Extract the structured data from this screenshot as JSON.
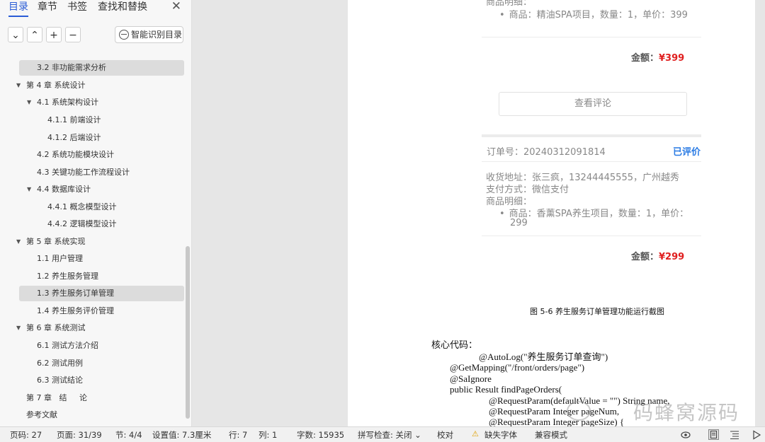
{
  "sidebar": {
    "tabs": [
      "目录",
      "章节",
      "书签",
      "查找和替换"
    ],
    "close_glyph": "✕",
    "tool_buttons": [
      "⌄",
      "⌃",
      "+",
      "−"
    ],
    "ai_button_label": "智能识别目录",
    "toc_items": [
      {
        "label": "3.2  非功能需求分析"
      },
      {
        "label": "第 4 章  系统设计"
      },
      {
        "label": "4.1  系统架构设计"
      },
      {
        "label": "4.1.1  前端设计"
      },
      {
        "label": "4.1.2  后端设计"
      },
      {
        "label": "4.2  系统功能模块设计"
      },
      {
        "label": "4.3  关键功能工作流程设计"
      },
      {
        "label": "4.4  数据库设计"
      },
      {
        "label": "4.4.1  概念模型设计"
      },
      {
        "label": "4.4.2  逻辑模型设计"
      },
      {
        "label": "第 5 章  系统实现"
      },
      {
        "label": "1.1  用户管理"
      },
      {
        "label": "1.2  养生服务管理"
      },
      {
        "label": "1.3  养生服务订单管理"
      },
      {
        "label": "1.4  养生服务评价管理"
      },
      {
        "label": "第 6 章  系统测试"
      },
      {
        "label": "6.1  测试方法介绍"
      },
      {
        "label": "6.2  测试用例"
      },
      {
        "label": "6.3  测试结论"
      },
      {
        "label": "第 7 章   结     论"
      },
      {
        "label": "参考文献"
      }
    ]
  },
  "document": {
    "top_partial": "商品明细：",
    "order1_item": "商品：精油SPA项目，数量：1，单价：399",
    "amount_label": "金额：",
    "order1_amount": "¥399",
    "review_button": "查看评论",
    "order2_number": "订单号：20240312091814",
    "order2_status": "已评价",
    "order2_address": "收货地址：张三疯，13244445555，广州越秀",
    "order2_payment": "支付方式：微信支付",
    "order2_details_label": "商品明细：",
    "order2_item_line1": "商品：香薰SPA养生项目，数量：1，单价：",
    "order2_item_line2": "299",
    "order2_amount": "¥299",
    "figure_caption": "图 5-6  养生服务订单管理功能运行截图",
    "core_code_label": "核心代码：",
    "code_lines": [
      "@AutoLog(\"养生服务订单查询\")",
      "@GetMapping(\"/front/orders/page\")",
      "@SaIgnore",
      "public Result findPageOrders(",
      "@RequestParam(defaultValue = \"\") String name,",
      "@RequestParam Integer pageNum,",
      "@RequestParam Integer pageSize) {"
    ],
    "watermark": "码蜂窝源码"
  },
  "statusbar": {
    "page_no": "页码: 27",
    "page_of": "页面: 31/39",
    "section": "节: 4/4",
    "setting": "设置值: 7.3厘米",
    "row": "行: 7",
    "col": "列: 1",
    "word_count": "字数: 15935",
    "spellcheck": "拼写检查: 关闭 ⌄",
    "proofread": "校对",
    "missing_font": "缺失字体",
    "compat_mode": "兼容模式"
  }
}
